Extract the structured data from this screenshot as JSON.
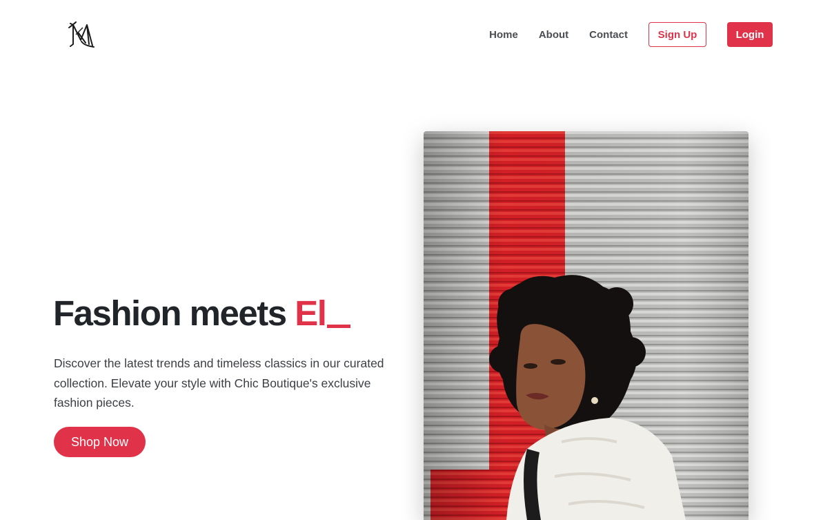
{
  "brand": {
    "logo_icon": "monogram-logo-icon"
  },
  "nav": {
    "links": [
      {
        "label": "Home"
      },
      {
        "label": "About"
      },
      {
        "label": "Contact"
      }
    ],
    "signup_label": "Sign Up",
    "login_label": "Login"
  },
  "hero": {
    "title_main": "Fashion meets ",
    "title_accent": "El",
    "description": "Discover the latest trends and timeless classics in our curated collection. Elevate your style with Chic Boutique's exclusive fashion pieces.",
    "cta_label": "Shop Now",
    "image_icon": "model-photo"
  },
  "colors": {
    "accent": "#e0334a",
    "heading": "#212529",
    "body_text": "#3b3f44",
    "nav_text": "#4a4d52"
  }
}
